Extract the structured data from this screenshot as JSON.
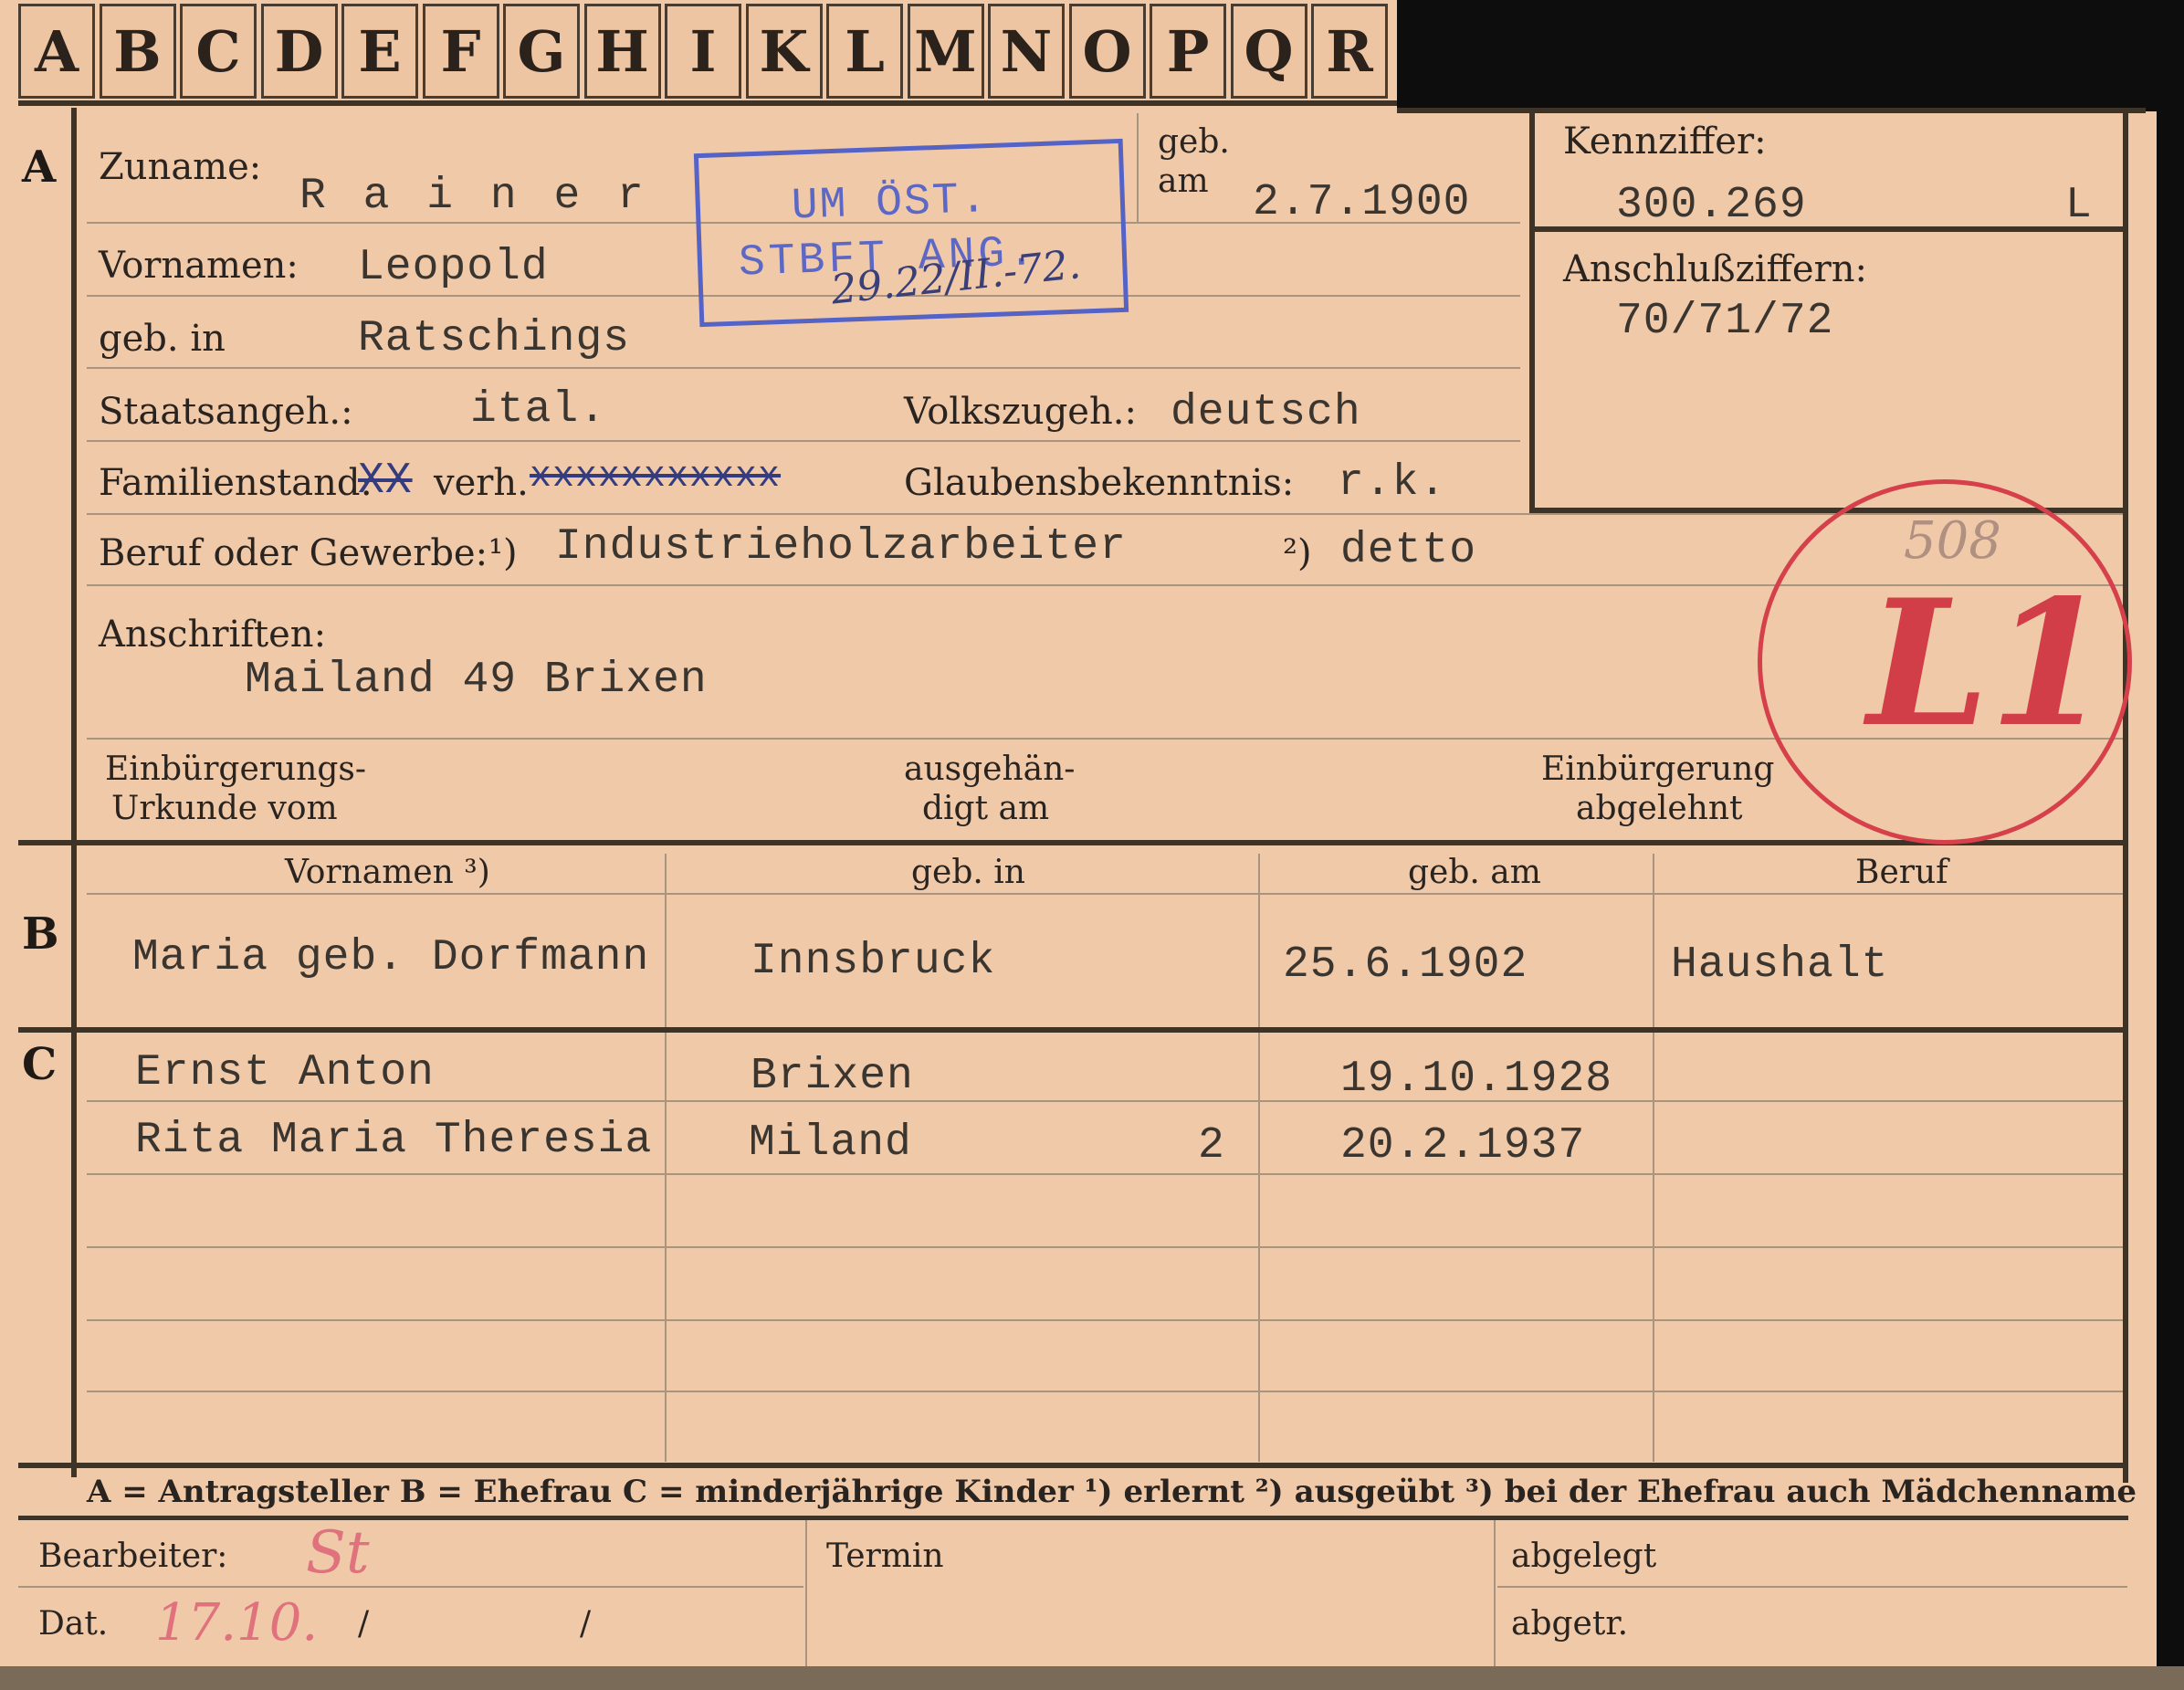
{
  "tabs": [
    "A",
    "B",
    "C",
    "D",
    "E",
    "F",
    "G",
    "H",
    "I",
    "K",
    "L",
    "M",
    "N",
    "O",
    "P",
    "Q",
    "R"
  ],
  "sections": {
    "a": "A",
    "b": "B",
    "c": "C"
  },
  "labels": {
    "zuname": "Zuname:",
    "geb_am_1": "geb.",
    "geb_am_2": "am",
    "kennziffer": "Kennziffer:",
    "vornamen": "Vornamen:",
    "anschlussziffern": "Anschlußziffern:",
    "geb_in": "geb. in",
    "staatsangeh": "Staatsangeh.:",
    "volkszugeh": "Volkszugeh.:",
    "familienstand": "Familienstand:",
    "glaubensbekenntnis": "Glaubensbekenntnis:",
    "beruf": "Beruf oder Gewerbe:",
    "beruf_1": "¹)",
    "beruf_2": "²)",
    "anschriften": "Anschriften:",
    "einb_urkunde_1": "Einbürgerungs-",
    "einb_urkunde_2": "Urkunde vom",
    "ausgehaendigt_1": "ausgehän-",
    "ausgehaendigt_2": "digt am",
    "einb_abgelehnt_1": "Einbürgerung",
    "einb_abgelehnt_2": "abgelehnt"
  },
  "applicant": {
    "zuname": "R a i n e r",
    "geb_am": "2.7.1900",
    "kennziffer": "300.269",
    "kennziffer_suffix": "L",
    "vornamen": "Leopold",
    "anschlussziffern": "70/71/72",
    "geb_in": "Ratschings",
    "staatsangeh": "ital.",
    "volkszugeh": "deutsch",
    "familienstand_struck": "XX",
    "familienstand": "verh.",
    "familienstand_struck2": "xxxxxxxxxxx",
    "glaubensbekenntnis": "r.k.",
    "beruf_erlernt": "Industrieholzarbeiter",
    "beruf_ausgeuebt": "detto",
    "anschrift": "Mailand 49 Brixen"
  },
  "stamp": {
    "line1": "UM ÖST.",
    "line2": "STBFT ANG.",
    "handwritten": "29.22/II.-72."
  },
  "red_marks": {
    "number": "508",
    "code": "L1"
  },
  "spouse_headers": [
    "Vornamen ³)",
    "geb. in",
    "geb. am",
    "Beruf"
  ],
  "spouse": {
    "vornamen": "Maria geb. Dorfmann",
    "geb_in": "Innsbruck",
    "geb_am": "25.6.1902",
    "beruf": "Haushalt"
  },
  "children": [
    {
      "vornamen": "Ernst Anton",
      "geb_in": "Brixen",
      "geb_am": "19.10.1928",
      "mark": ""
    },
    {
      "vornamen": "Rita Maria Theresia",
      "geb_in": "Miland",
      "geb_am": "20.2.1937",
      "mark": "2"
    }
  ],
  "legend": "A = Antragsteller   B = Ehefrau   C = minderjährige Kinder   ¹) erlernt   ²) ausgeübt   ³) bei der Ehefrau auch Mädchenname",
  "footer": {
    "bearbeiter": "Bearbeiter:",
    "bearbeiter_value": "St",
    "dat": "Dat.",
    "dat_value": "17.10.",
    "dat_sep1": "/",
    "dat_sep2": "/",
    "termin": "Termin",
    "abgelegt": "abgelegt",
    "abgetr": "abgetr."
  }
}
